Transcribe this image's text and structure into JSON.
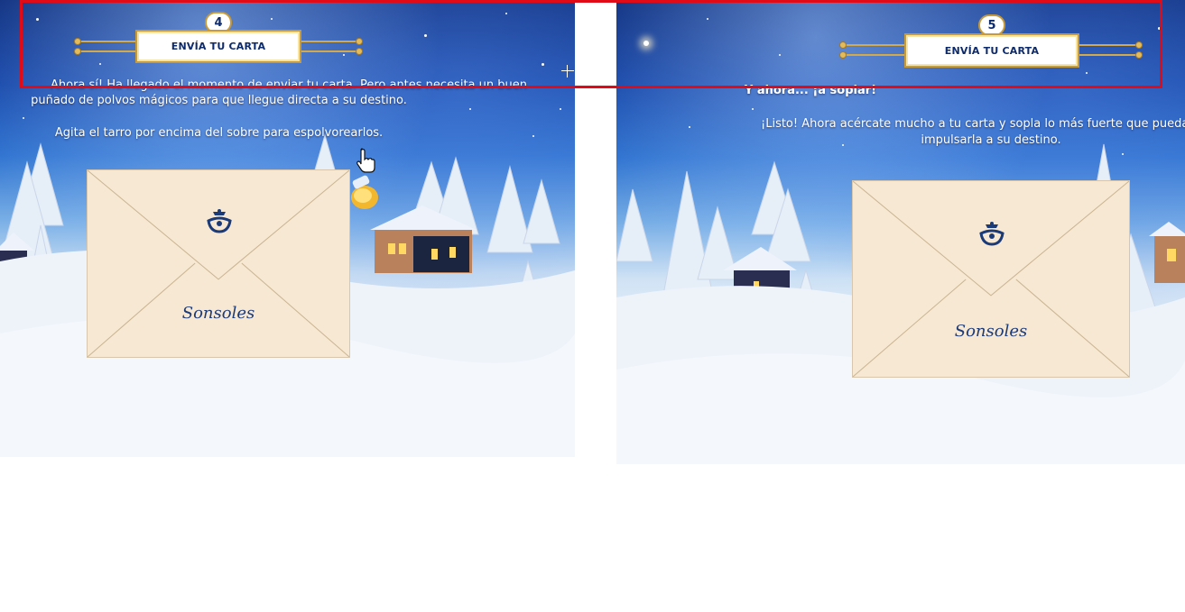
{
  "left_panel": {
    "step_number": "4",
    "title": "ENVÍA TU CARTA",
    "instruction_line1": "Ahora sí! Ha llegado el momento de enviar tu carta. Pero antes necesita un buen",
    "instruction_line2": "puñado de polvos mágicos para que llegue directa a su destino.",
    "instruction_line3": "Agita el tarro por encima del sobre para espolvorearlos.",
    "envelope_name": "Sonsoles"
  },
  "right_panel": {
    "step_number": "5",
    "title": "ENVÍA TU CARTA",
    "heading": "Y ahora... ¡a soplar!",
    "instruction_line1": "¡Listo! Ahora acércate mucho a tu carta y sopla lo más fuerte que puedas",
    "instruction_line2": "impulsarla a su destino.",
    "envelope_name": "Sonsoles"
  },
  "colors": {
    "highlight": "#e10b17",
    "gold": "#c79b3b",
    "navy": "#0d2a6b",
    "envelope": "#f7e8d3"
  },
  "icons": {
    "cursor": "hand-pointer-icon",
    "jar": "magic-dust-jar-icon",
    "logo": "correos-post-horn-icon"
  }
}
